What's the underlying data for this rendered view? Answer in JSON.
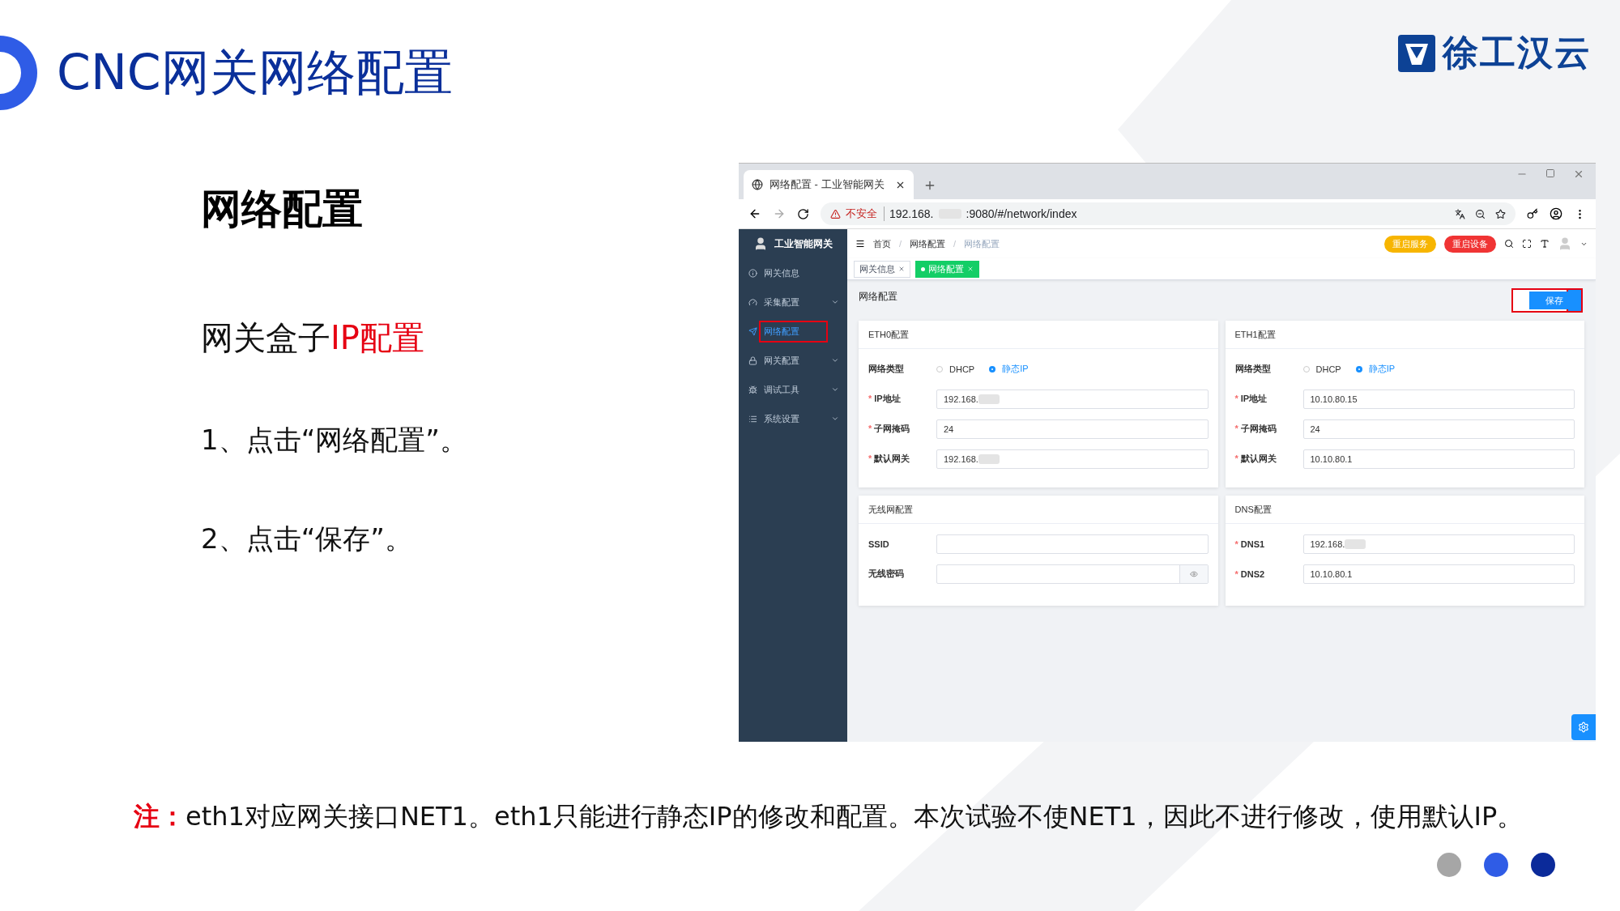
{
  "slide": {
    "title": "CNC网关网络配置",
    "logo_text": "徐工汉云",
    "heading": "网络配置",
    "subheading": [
      {
        "text": "网关盒子",
        "highlight": false
      },
      {
        "text": "IP配置",
        "highlight": true
      }
    ],
    "steps": [
      "1、点击“网络配置”。",
      "2、点击“保存”。"
    ],
    "note": {
      "label": "注：",
      "text": "eth1对应网关接口NET1。eth1只能进行静态IP的修改和配置。本次试验不使NET1，因此不进行修改，使用默认IP。"
    },
    "pager": [
      {
        "color": "#a6a6a6"
      },
      {
        "color": "#2f5ce6"
      },
      {
        "color": "#0b2a9a"
      }
    ]
  },
  "browser": {
    "tab_title": "网络配置 - 工业智能网关",
    "security_label": "不安全",
    "url_host": "192.168.",
    "url_rest": ":9080/#/network/index"
  },
  "app": {
    "brand": "工业智能网关",
    "menu": [
      {
        "kind": "info",
        "label": "网关信息",
        "selected": false,
        "expandable": false,
        "annotated": false
      },
      {
        "kind": "gauge",
        "label": "采集配置",
        "selected": false,
        "expandable": true,
        "annotated": false
      },
      {
        "kind": "send",
        "label": "网络配置",
        "selected": true,
        "expandable": false,
        "annotated": true
      },
      {
        "kind": "lock",
        "label": "网关配置",
        "selected": false,
        "expandable": true,
        "annotated": false
      },
      {
        "kind": "bug",
        "label": "调试工具",
        "selected": false,
        "expandable": true,
        "annotated": false
      },
      {
        "kind": "list",
        "label": "系统设置",
        "selected": false,
        "expandable": true,
        "annotated": false
      }
    ],
    "breadcrumb": [
      "首页",
      "网络配置",
      "网络配置"
    ],
    "breadcrumb_separator": "/",
    "required_mark": "*",
    "header_buttons": [
      {
        "label": "重启服务",
        "kind": "warning"
      },
      {
        "label": "重启设备",
        "kind": "danger"
      }
    ],
    "tags": [
      {
        "label": "网关信息",
        "selected": false
      },
      {
        "label": "网络配置",
        "selected": true
      }
    ],
    "page_title": "网络配置",
    "save_button": {
      "label": "保存",
      "annotated": true
    },
    "cards": [
      {
        "title": "ETH0配置",
        "rows": [
          {
            "kind": "radio",
            "label": "网络类型",
            "options": [
              {
                "label": "DHCP",
                "selected": false
              },
              {
                "label": "静态IP",
                "selected": true
              }
            ]
          },
          {
            "kind": "text",
            "label": "IP地址",
            "required": true,
            "value": "192.168.",
            "blurred": true
          },
          {
            "kind": "text",
            "label": "子网掩码",
            "required": true,
            "value": "24",
            "blurred": false
          },
          {
            "kind": "text",
            "label": "默认网关",
            "required": true,
            "value": "192.168.",
            "blurred": true
          }
        ]
      },
      {
        "title": "ETH1配置",
        "rows": [
          {
            "kind": "radio",
            "label": "网络类型",
            "options": [
              {
                "label": "DHCP",
                "selected": false
              },
              {
                "label": "静态IP",
                "selected": true
              }
            ]
          },
          {
            "kind": "text",
            "label": "IP地址",
            "required": true,
            "value": "10.10.80.15",
            "blurred": false
          },
          {
            "kind": "text",
            "label": "子网掩码",
            "required": true,
            "value": "24",
            "blurred": false
          },
          {
            "kind": "text",
            "label": "默认网关",
            "required": true,
            "value": "10.10.80.1",
            "blurred": false
          }
        ]
      },
      {
        "title": "无线网配置",
        "rows": [
          {
            "kind": "text",
            "label": "SSID",
            "required": false,
            "blurred": false
          },
          {
            "kind": "password",
            "label": "无线密码",
            "required": false,
            "blurred": false
          }
        ]
      },
      {
        "title": "DNS配置",
        "rows": [
          {
            "kind": "text",
            "label": "DNS1",
            "required": true,
            "value": "192.168.",
            "blurred": true
          },
          {
            "kind": "text",
            "label": "DNS2",
            "required": true,
            "value": "10.10.80.1",
            "blurred": false
          }
        ]
      }
    ]
  }
}
